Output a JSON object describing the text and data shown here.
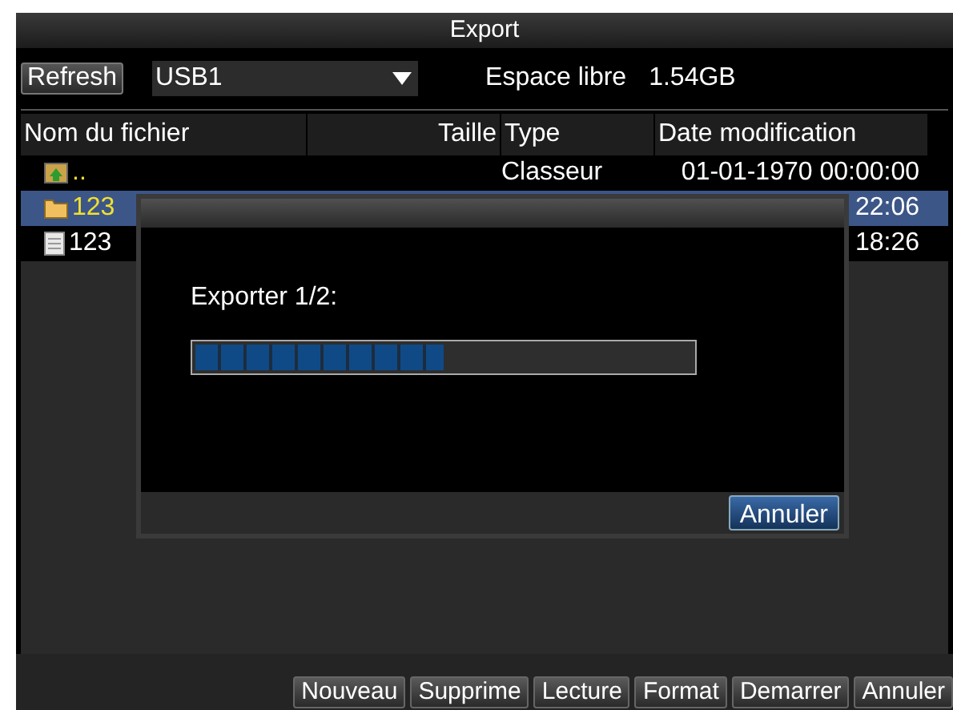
{
  "window": {
    "title": "Export"
  },
  "toolbar": {
    "refresh": "Refresh",
    "device": "USB1",
    "free_space_label": "Espace libre",
    "free_space_value": "1.54GB"
  },
  "table": {
    "columns": [
      "Nom du fichier",
      "Taille",
      "Type",
      "Date modification"
    ],
    "rows": [
      {
        "kind": "parent",
        "name": "..",
        "type": "Classeur",
        "date": "01-01-1970 00:00:00",
        "selected": false
      },
      {
        "kind": "folder",
        "name": "123",
        "type": "",
        "date": "22:06",
        "selected": true
      },
      {
        "kind": "file",
        "name": "123",
        "type": "",
        "date": "18:26",
        "selected": false
      }
    ]
  },
  "dialog": {
    "label": "Exporter 1/2:",
    "level": 0.5,
    "button": "Annuler"
  },
  "buttons": [
    "Nouveau",
    "Supprime",
    "Lecture",
    "Format",
    "Demarrer",
    "Annuler"
  ]
}
